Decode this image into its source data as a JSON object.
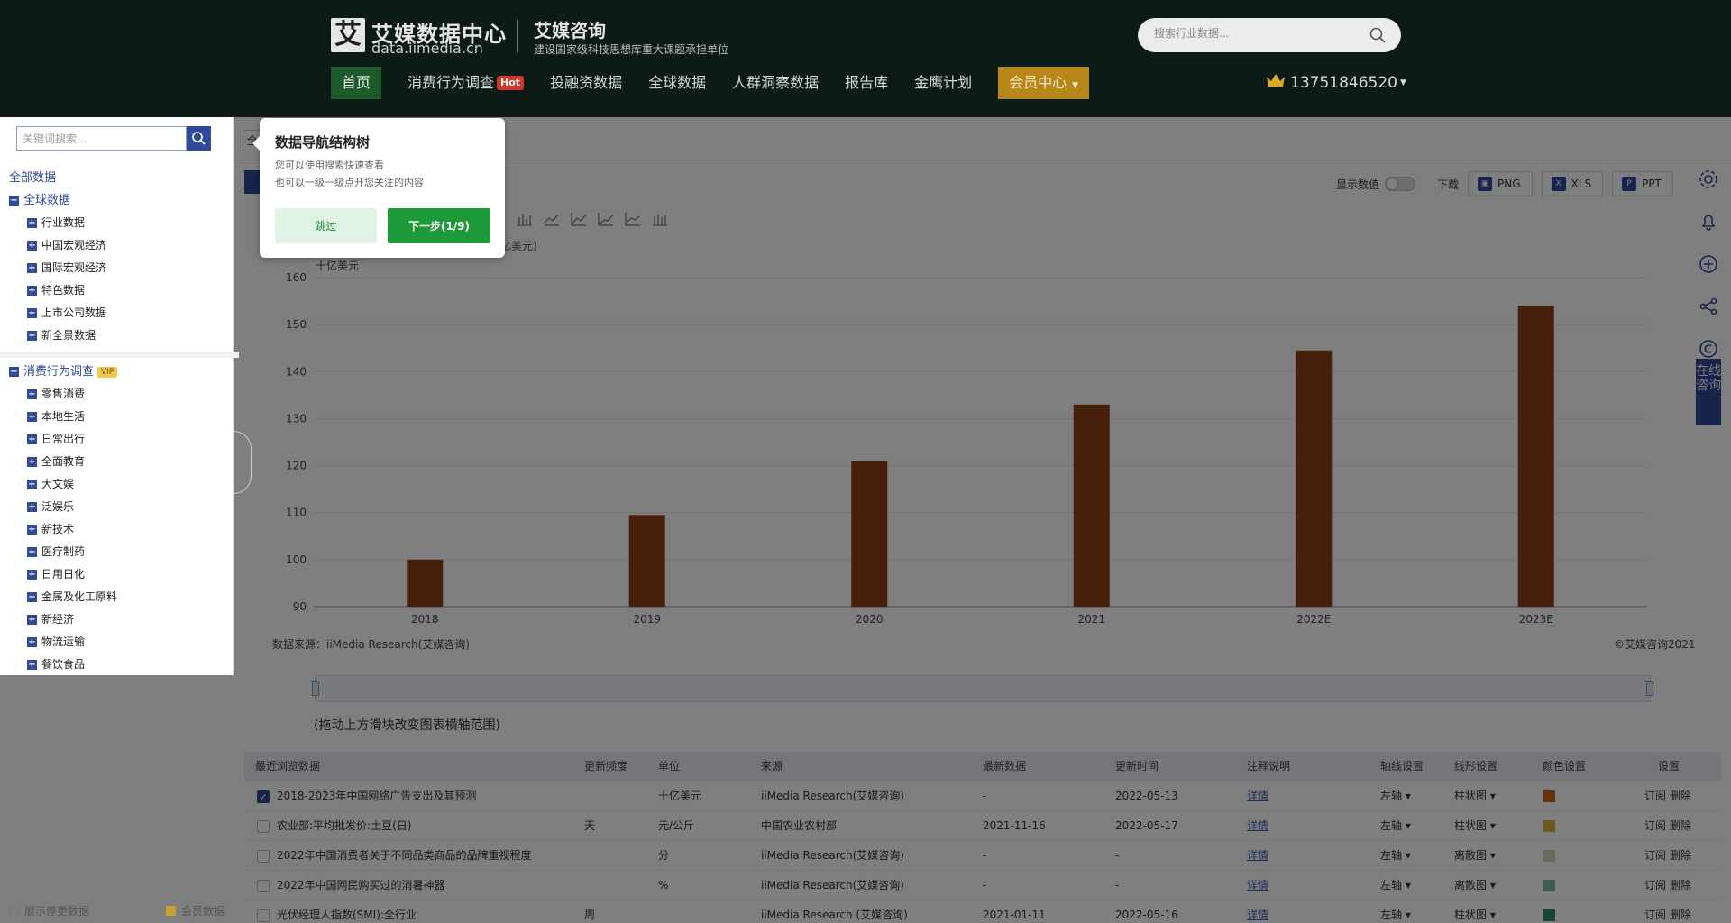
{
  "header": {
    "logo_char": "艾",
    "logo_cn": "艾媒数据中心",
    "logo_url": "data.iimedia.cn",
    "brand": "艾媒咨询",
    "tagline": "建设国家级科技思想库重大课题承担单位",
    "search_placeholder": "搜索行业数据...",
    "nav": [
      {
        "label": "首页",
        "active": true
      },
      {
        "label": "消费行为调查",
        "badge": "Hot"
      },
      {
        "label": "投融资数据"
      },
      {
        "label": "全球数据"
      },
      {
        "label": "人群洞察数据"
      },
      {
        "label": "报告库"
      },
      {
        "label": "金鹰计划"
      },
      {
        "label": "会员中心"
      }
    ],
    "user_phone": "13751846520"
  },
  "toolbar": {
    "tab_label": "全",
    "show_data_label": "显示数值",
    "download_label": "下载",
    "png": "PNG",
    "xls": "XLS",
    "ppt": "PPT",
    "subtitle_fragment": "亿美元)"
  },
  "chart_data": {
    "type": "bar",
    "categories": [
      "2018",
      "2019",
      "2020",
      "2021",
      "2022E",
      "2023E"
    ],
    "values": [
      100.0,
      109.5,
      121.0,
      133.0,
      144.5,
      154.0
    ],
    "ylabel": "十亿美元",
    "ylim": [
      90,
      160
    ],
    "yticks": [
      90,
      100,
      110,
      120,
      130,
      140,
      150,
      160
    ],
    "color": "#8a3e12",
    "grid": true
  },
  "chart_footer": {
    "source": "数据来源：iiMedia Research(艾媒咨询)",
    "copyright": "©艾媒咨询2021",
    "slider_hint": "(拖动上方滑块改变图表横轴范围)"
  },
  "table": {
    "headers": [
      "最近浏览数据",
      "更新频度",
      "单位",
      "来源",
      "最新数据",
      "更新时间",
      "注释说明",
      "轴线设置",
      "线形设置",
      "颜色设置",
      "设置"
    ],
    "rows": [
      {
        "checked": true,
        "name": "2018-2023年中国网络广告支出及其预测",
        "freq": "",
        "unit": "十亿美元",
        "source": "iiMedia Research(艾媒咨询)",
        "latest": "-",
        "updated": "2022-05-13",
        "note": "详情",
        "axis": "左轴",
        "shape": "柱状图",
        "color": "#c8611a",
        "ops": "订阅 删除"
      },
      {
        "checked": false,
        "name": "农业部:平均批发价:土豆(日)",
        "freq": "天",
        "unit": "元/公斤",
        "source": "中国农业农村部",
        "latest": "2021-11-16",
        "updated": "2022-05-17",
        "note": "详情",
        "axis": "左轴",
        "shape": "柱状图",
        "color": "#d8b23a",
        "ops": "订阅 删除"
      },
      {
        "checked": false,
        "name": "2022年中国消费者关于不同品类商品的品牌重视程度",
        "freq": "",
        "unit": "分",
        "source": "iiMedia Research(艾媒咨询)",
        "latest": "-",
        "updated": "-",
        "note": "详情",
        "axis": "左轴",
        "shape": "离散图",
        "color": "#cfd8b8",
        "ops": "订阅 删除"
      },
      {
        "checked": false,
        "name": "2022年中国网民购买过的消暑神器",
        "freq": "",
        "unit": "%",
        "source": "iiMedia Research(艾媒咨询)",
        "latest": "-",
        "updated": "-",
        "note": "详情",
        "axis": "左轴",
        "shape": "离散图",
        "color": "#79b8a8",
        "ops": "订阅 删除"
      },
      {
        "checked": false,
        "name": "光伏经理人指数(SMI):全行业",
        "freq": "周",
        "unit": "",
        "source": "iiMedia Research (艾媒咨询)",
        "latest": "2021-01-11",
        "updated": "2022-05-16",
        "note": "详情",
        "axis": "左轴",
        "shape": "柱状图",
        "color": "#2a8a6a",
        "ops": "订阅 删除"
      }
    ]
  },
  "rail": {
    "consult": "在线咨询"
  },
  "sidebar": {
    "search_placeholder": "关键词搜索...",
    "all": "全部数据",
    "groups": [
      {
        "label": "全球数据",
        "vip": "",
        "items": [
          "行业数据",
          "中国宏观经济",
          "国际宏观经济",
          "特色数据",
          "上市公司数据",
          "新全景数据"
        ]
      },
      {
        "label": "消费行为调查",
        "vip": "VIP",
        "items": [
          "零售消费",
          "本地生活",
          "日常出行",
          "全面教育",
          "大文娱",
          "泛娱乐",
          "新技术",
          "医疗制药",
          "日用日化",
          "金属及化工原料",
          "新经济",
          "物流运输",
          "餐饮食品"
        ]
      }
    ],
    "bottom_left": "展示停更数据",
    "bottom_right": "会员数据"
  },
  "guide": {
    "title": "数据导航结构树",
    "line1": "您可以使用搜索快速查看",
    "line2": "也可以一级一级点开您关注的内容",
    "skip": "跳过",
    "next": "下一步(1/9)"
  }
}
